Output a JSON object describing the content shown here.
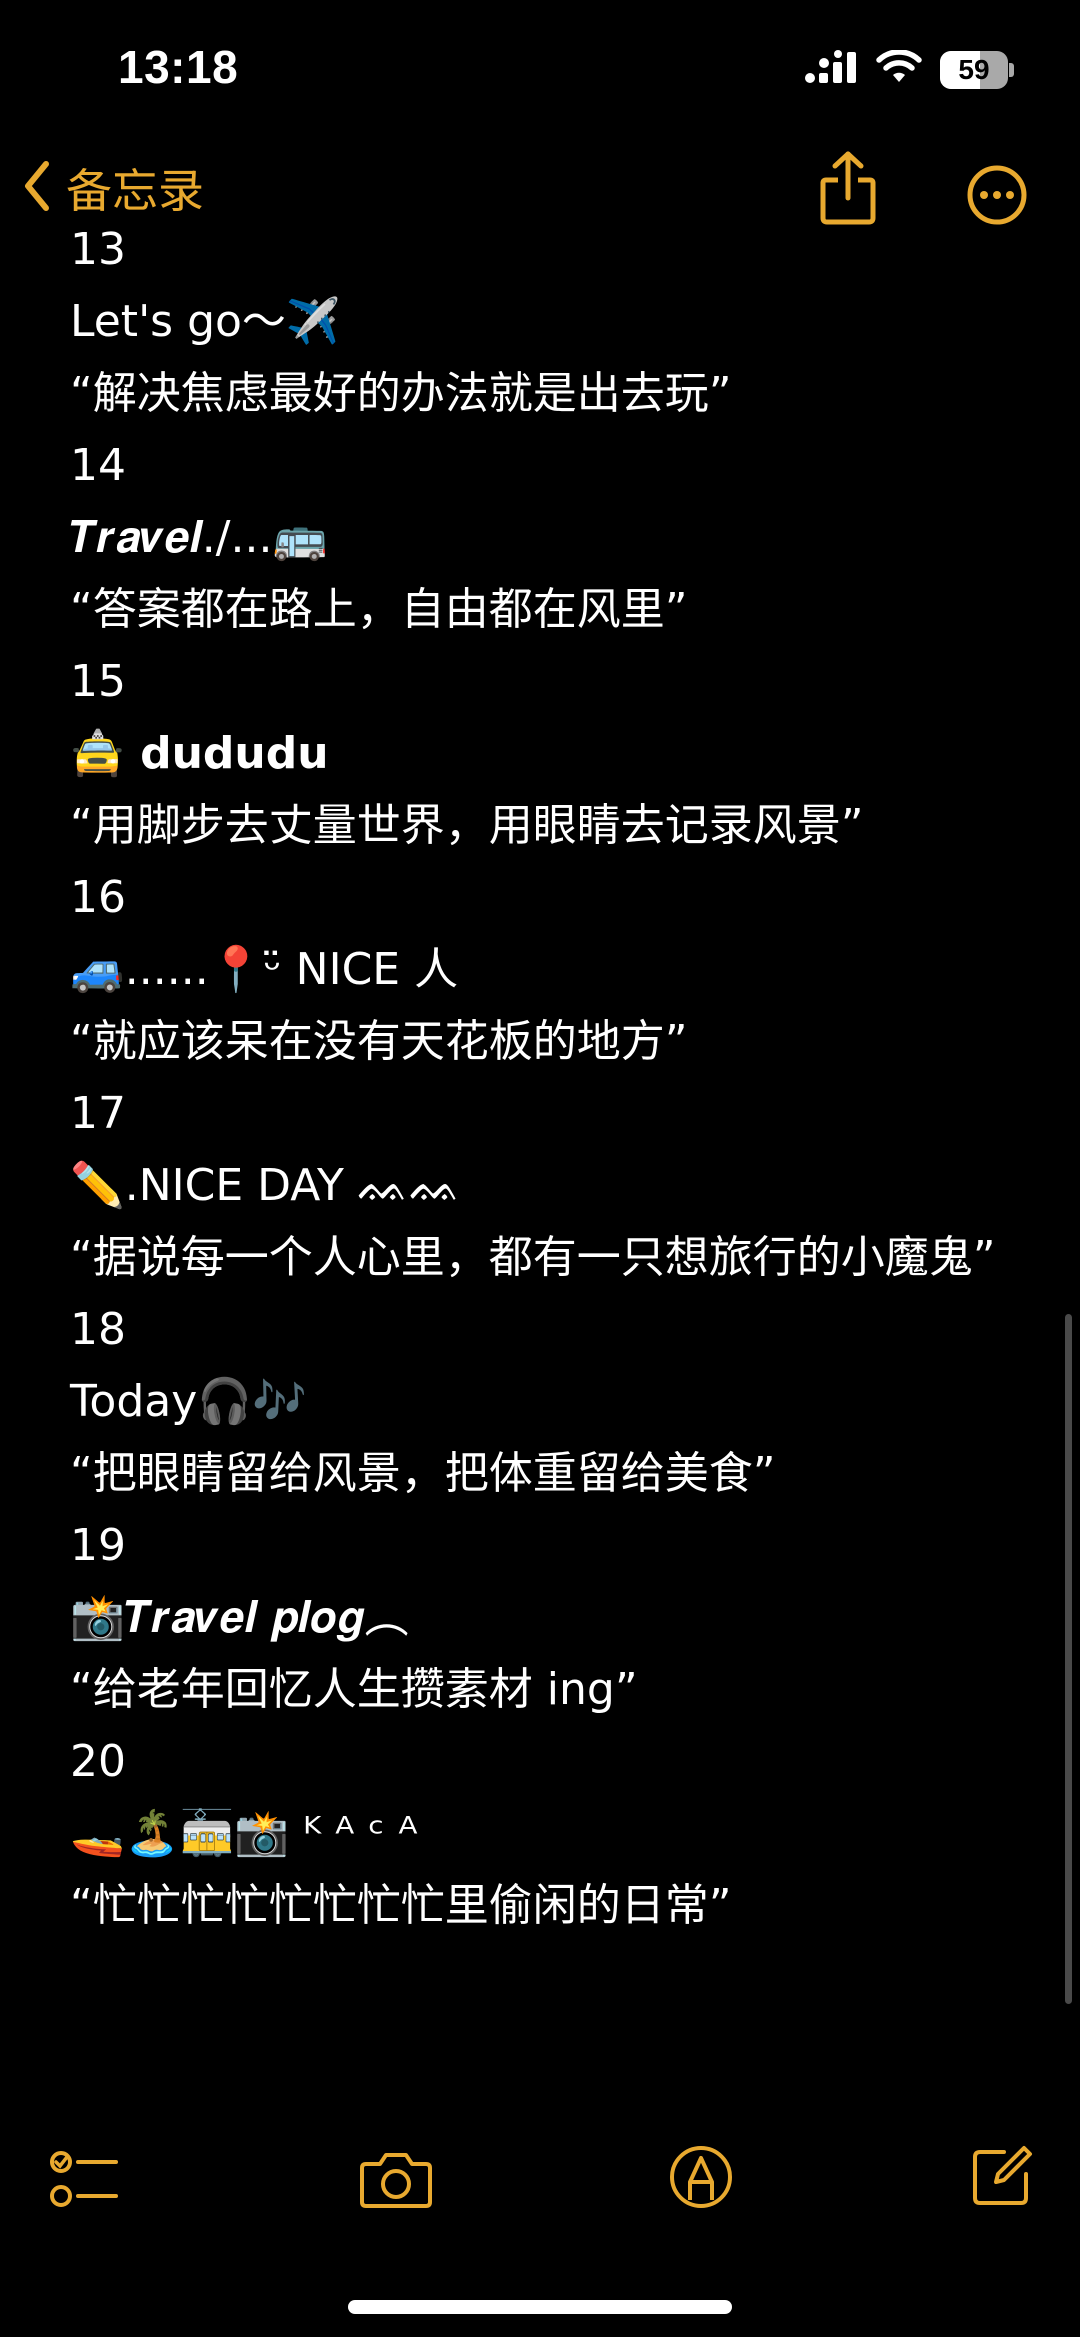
{
  "status_bar": {
    "time": "13:18",
    "battery_percent": 59,
    "battery_text": "59"
  },
  "nav": {
    "back_label": "备忘录",
    "accent_color": "#e8a92f"
  },
  "note": {
    "lines": [
      "13",
      "Let's go～✈️",
      "“解决焦虑最好的办法就是出去玩”",
      "14",
      "𝑻𝒓𝒂𝒗𝒆𝒍./...🚌",
      "“答案都在路上，自由都在风里”",
      "15",
      "🚖 dududu",
      "“用脚步去丈量世界，用眼睛去记录风景”",
      "16",
      "🚙......📍ᵕ̈ NICE 人",
      "“就应该呆在没有天花板的地方”",
      "17",
      "✏️.NICE DAY ᨐᨐ",
      "“据说每一个人心里，都有一只想旅行的小魔鬼”",
      "18",
      "Today🎧🎶",
      "“把眼睛留给风景，把体重留给美食”",
      "19",
      "📸𝑻𝒓𝒂𝒗𝒆𝒍 𝒑𝒍𝒐𝒈︵",
      "“给老年回忆人生攒素材 ing”",
      "20",
      "🚤🏝️🚋📸 ᴷ ᴬ ᶜ ᴬ",
      "“忙忙忙忙忙忙忙忙里偷闲的日常”"
    ]
  },
  "toolbar": {
    "icons": [
      "checklist-icon",
      "camera-icon",
      "markup-icon",
      "compose-icon"
    ]
  }
}
